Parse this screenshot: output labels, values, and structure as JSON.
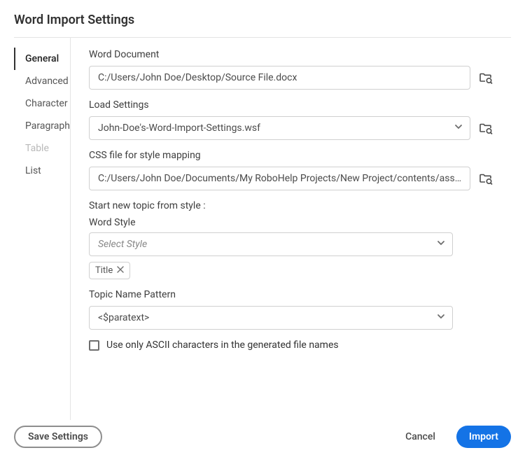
{
  "title": "Word Import Settings",
  "sidebar": {
    "items": [
      {
        "label": "General",
        "state": "selected"
      },
      {
        "label": "Advanced",
        "state": "normal"
      },
      {
        "label": "Character",
        "state": "normal"
      },
      {
        "label": "Paragraph",
        "state": "normal"
      },
      {
        "label": "Table",
        "state": "disabled"
      },
      {
        "label": "List",
        "state": "normal"
      }
    ]
  },
  "fields": {
    "word_document": {
      "label": "Word Document",
      "value": "C:/Users/John Doe/Desktop/Source File.docx"
    },
    "load_settings": {
      "label": "Load Settings",
      "value": "John-Doe's-Word-Import-Settings.wsf"
    },
    "css_file": {
      "label": "CSS file for style mapping",
      "value": "C:/Users/John Doe/Documents/My RoboHelp Projects/New Project/contents/ass…"
    },
    "topic_split": {
      "label": "Start new topic from style :",
      "sublabel": "Word Style",
      "placeholder": "Select Style",
      "chips": [
        "Title"
      ]
    },
    "topic_name_pattern": {
      "label": "Topic Name Pattern",
      "value": "<$paratext>"
    },
    "ascii_checkbox": {
      "label": "Use only ASCII characters in the generated file names",
      "checked": false
    }
  },
  "footer": {
    "save": "Save Settings",
    "cancel": "Cancel",
    "import": "Import"
  }
}
